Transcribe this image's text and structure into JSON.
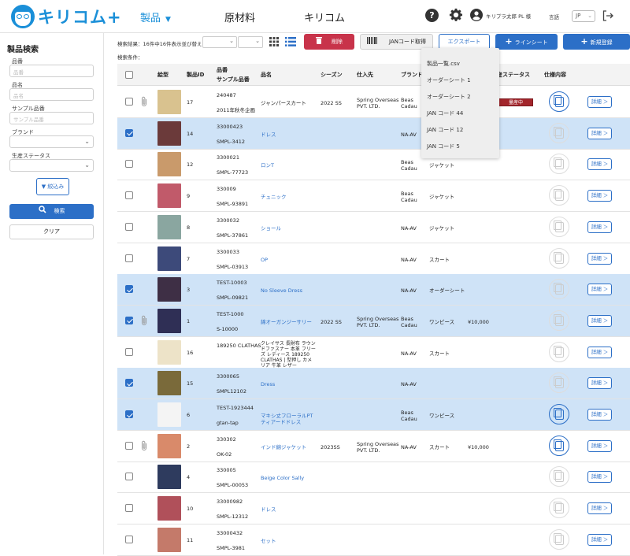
{
  "header": {
    "logo_text": "キリコム+",
    "nav": [
      {
        "label": "製品",
        "active": true
      },
      {
        "label": "原材料"
      },
      {
        "label": "キリコム"
      }
    ],
    "help_icon": "question-circle-icon",
    "settings_icon": "gear-icon",
    "user_icon": "user-circle-icon",
    "user_name": "キリプラ太郎 PL 様",
    "lang_label": "言語",
    "lang_value": "JP",
    "logout_icon": "logout-icon",
    "accent": "#1a8fd8"
  },
  "sidebar": {
    "title": "製品検索",
    "fields": [
      {
        "label": "品番",
        "placeholder": "品番"
      },
      {
        "label": "品名",
        "placeholder": "品名"
      },
      {
        "label": "サンプル品番",
        "placeholder": "サンプル品番"
      }
    ],
    "brand_label": "ブランド",
    "status_label": "生産ステータス",
    "narrow_label": "絞込み",
    "search_label": "検索",
    "clear_label": "クリア"
  },
  "toolbar": {
    "result_text": "検索結果：16件中16件表示",
    "sort_label": "並び替え",
    "delete_label": "削除",
    "jan_label": "JANコード取得",
    "export_label": "エクスポート",
    "linesheet_label": "ラインシート",
    "new_label": "新規登録",
    "condition_label": "検索条件：",
    "danger_color": "#c8334a",
    "primary_color": "#2c6fc7"
  },
  "export_menu": [
    "製品一覧.csv",
    "オーダーシート 1",
    "オーダーシート 2",
    "JAN コード 44",
    "JAN コード 12",
    "JAN コード 5"
  ],
  "table": {
    "headers": {
      "shape": "絵型",
      "product_id": "製品ID",
      "code": "品番",
      "sample_code": "サンプル品番",
      "name": "品名",
      "season": "シーズン",
      "supplier": "仕入先",
      "brand": "ブランド",
      "status": "生産ステータス",
      "spec": "仕様内容"
    },
    "detail_label": "詳細 ＞",
    "rows": [
      {
        "selected": false,
        "clip": true,
        "thumb": "#d9c28f",
        "id": "17",
        "code": "240487",
        "sample": "2011年秋冬企画",
        "name": "ジャンパースカート",
        "name_link": false,
        "season": "2022 SS",
        "supplier": "Spring Overseas PVT. LTD.",
        "brand": "Beas Cadau",
        "category": "",
        "price": "",
        "status": "量産中",
        "spec_active": true
      },
      {
        "selected": true,
        "clip": false,
        "thumb": "#6b3a3a",
        "id": "14",
        "code": "33000423",
        "sample": "SMPL-3412",
        "name": "ドレス",
        "name_link": true,
        "season": "",
        "supplier": "",
        "brand": "NA-AV",
        "category": "",
        "price": "",
        "status": "",
        "spec_active": false
      },
      {
        "selected": false,
        "clip": false,
        "thumb": "#c99a6b",
        "id": "12",
        "code": "3300021",
        "sample": "SMPL-77723",
        "name": "ロンT",
        "name_link": true,
        "season": "",
        "supplier": "",
        "brand": "Beas Cadau",
        "category": "ジャケット",
        "price": "",
        "status": "",
        "spec_active": false
      },
      {
        "selected": false,
        "clip": false,
        "thumb": "#c15a6a",
        "id": "9",
        "code": "330009",
        "sample": "SMPL-93891",
        "name": "チュニック",
        "name_link": true,
        "season": "",
        "supplier": "",
        "brand": "Beas Cadau",
        "category": "ジャケット",
        "price": "",
        "status": "",
        "spec_active": false
      },
      {
        "selected": false,
        "clip": false,
        "thumb": "#8aa6a0",
        "id": "8",
        "code": "3300032",
        "sample": "SMPL-37861",
        "name": "ショール",
        "name_link": true,
        "season": "",
        "supplier": "",
        "brand": "NA-AV",
        "category": "ジャケット",
        "price": "",
        "status": "",
        "spec_active": false
      },
      {
        "selected": false,
        "clip": false,
        "thumb": "#3d4a7a",
        "id": "7",
        "code": "3300033",
        "sample": "SMPL-03913",
        "name": "OP",
        "name_link": true,
        "season": "",
        "supplier": "",
        "brand": "NA-AV",
        "category": "スカート",
        "price": "",
        "status": "",
        "spec_active": false
      },
      {
        "selected": true,
        "clip": false,
        "thumb": "#3e2f45",
        "id": "3",
        "code": "TEST-10003",
        "sample": "SMPL-09821",
        "name": "No Sleeve Dress",
        "name_link": true,
        "season": "",
        "supplier": "",
        "brand": "NA-AV",
        "category": "オーダーシート",
        "price": "",
        "status": "",
        "spec_active": false
      },
      {
        "selected": true,
        "clip": true,
        "thumb": "#2f2f55",
        "id": "1",
        "code": "TEST-1000",
        "sample": "S-10000",
        "name": "綿オーガンジーサリー",
        "name_link": true,
        "season": "2022 SS",
        "supplier": "Spring Overseas PVT. LTD.",
        "brand": "Beas Cadau",
        "category": "ワンピース",
        "price": "¥10,000",
        "status": "",
        "spec_active": false
      },
      {
        "selected": false,
        "clip": false,
        "thumb": "#ede3c8",
        "id": "16",
        "code": "189250 CLATHAS",
        "sample": "",
        "name": "クレイサス 長財布 ラウンドファスナー 本革 フリーズ レディース 189250 CLATHAS | 型押し カメリア 牛革 レザー",
        "name_link": false,
        "season": "",
        "supplier": "",
        "brand": "NA-AV",
        "category": "スカート",
        "price": "",
        "status": "",
        "spec_active": false
      },
      {
        "selected": true,
        "clip": false,
        "thumb": "#7a6a3a",
        "id": "15",
        "code": "3300065",
        "sample": "SMPL12102",
        "name": "Dress",
        "name_link": true,
        "season": "",
        "supplier": "",
        "brand": "NA-AV",
        "category": "",
        "price": "",
        "status": "",
        "spec_active": false
      },
      {
        "selected": true,
        "clip": false,
        "thumb": "#f4f4f4",
        "id": "6",
        "code": "TEST-1923444",
        "sample": "gtan-tap",
        "name": "マキシ丈フローラルPTティアードドレス",
        "name_link": true,
        "season": "",
        "supplier": "",
        "brand": "Beas Cadau",
        "category": "ワンピース",
        "price": "",
        "status": "",
        "spec_active": true
      },
      {
        "selected": false,
        "clip": true,
        "thumb": "#d98a6a",
        "id": "2",
        "code": "330302",
        "sample": "OK-02",
        "name": "インド綿ジャケット",
        "name_link": true,
        "season": "2023SS",
        "supplier": "Spring Overseas PVT. LTD.",
        "brand": "NA-AV",
        "category": "スカート",
        "price": "¥10,000",
        "status": "",
        "spec_active": true
      },
      {
        "selected": false,
        "clip": false,
        "thumb": "#2e3b5e",
        "id": "4",
        "code": "330005",
        "sample": "SMPL-00053",
        "name": "Beige Color Sally",
        "name_link": true,
        "season": "",
        "supplier": "",
        "brand": "",
        "category": "",
        "price": "",
        "status": "",
        "spec_active": false
      },
      {
        "selected": false,
        "clip": false,
        "thumb": "#b0505a",
        "id": "10",
        "code": "33000982",
        "sample": "SMPL-12312",
        "name": "ドレス",
        "name_link": true,
        "season": "",
        "supplier": "",
        "brand": "",
        "category": "",
        "price": "",
        "status": "",
        "spec_active": false
      },
      {
        "selected": false,
        "clip": false,
        "thumb": "#c47a6a",
        "id": "11",
        "code": "33000432",
        "sample": "SMPL-3981",
        "name": "セット",
        "name_link": true,
        "season": "",
        "supplier": "",
        "brand": "",
        "category": "",
        "price": "",
        "status": "",
        "spec_active": false
      }
    ]
  }
}
